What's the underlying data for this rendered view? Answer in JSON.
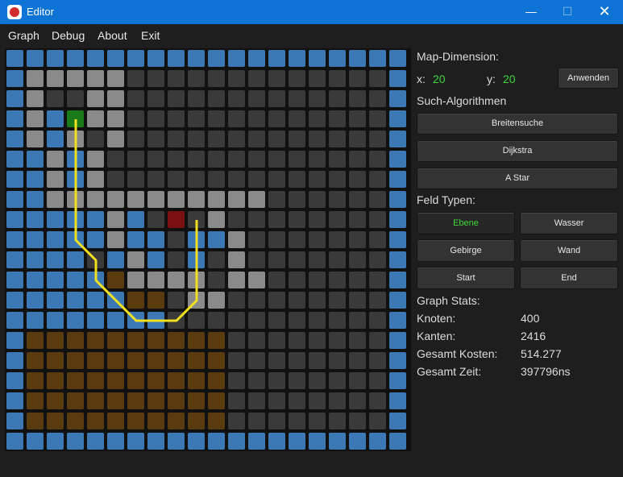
{
  "window": {
    "title": "Editor",
    "minimize": "—",
    "maximize": "☐",
    "close": "✕"
  },
  "menu": [
    "Graph",
    "Debug",
    "About",
    "Exit"
  ],
  "colors": {
    "water": "#3c78b4",
    "plain": "#3a3a3a",
    "wall": "#8a8a8a",
    "mountain": "#5a3b10",
    "start": "#1a7a1a",
    "end": "#7a1010",
    "path": "#f0e020",
    "accent_text": "#3cd83c"
  },
  "grid": {
    "size": 20,
    "rows": [
      "WWWWWWWWWWWWWWWWWWWW",
      "WMMMMM.............W",
      "WM..MM.............W",
      "WMWSMM.............W",
      "WMWM.M.............W",
      "WWMWM..............W",
      "WWMWM..............W",
      "WWMMMMMMMMMMM......W",
      "WWWWWMW.E.M........W",
      "WWWWWMWW.WWM.......W",
      "WWWW.WMW.W.M.......W",
      "WWWWW#MMMM.MM......W",
      "WWWWWW##.MM........W",
      "WWWWWWWW...........W",
      "W##########........W",
      "W##########........W",
      "W##########........W",
      "W##########........W",
      "W##########........W",
      "WWWWWWWWWWWWWWWWWWWW"
    ],
    "path": [
      [
        3,
        3
      ],
      [
        3,
        9
      ],
      [
        4,
        10
      ],
      [
        4,
        11
      ],
      [
        5,
        12
      ],
      [
        6,
        13
      ],
      [
        7,
        13
      ],
      [
        8,
        13
      ],
      [
        9,
        12
      ],
      [
        9,
        11
      ],
      [
        9,
        8
      ]
    ]
  },
  "panel": {
    "map_dimension_label": "Map-Dimension:",
    "x_label": "x:",
    "x_value": "20",
    "y_label": "y:",
    "y_value": "20",
    "apply_button": "Anwenden",
    "algorithms_label": "Such-Algorithmen",
    "algorithms": [
      "Breitensuche",
      "Dijkstra",
      "A Star"
    ],
    "field_types_label": "Feld Typen:",
    "field_types": [
      "Ebene",
      "Wasser",
      "Gebirge",
      "Wand",
      "Start",
      "End"
    ],
    "selected_field_type": "Ebene",
    "stats_label": "Graph Stats:",
    "stats": [
      {
        "label": "Knoten:",
        "value": "400"
      },
      {
        "label": "Kanten:",
        "value": "2416"
      },
      {
        "label": "Gesamt Kosten:",
        "value": "514.277"
      },
      {
        "label": "Gesamt Zeit:",
        "value": "397796ns"
      }
    ]
  }
}
